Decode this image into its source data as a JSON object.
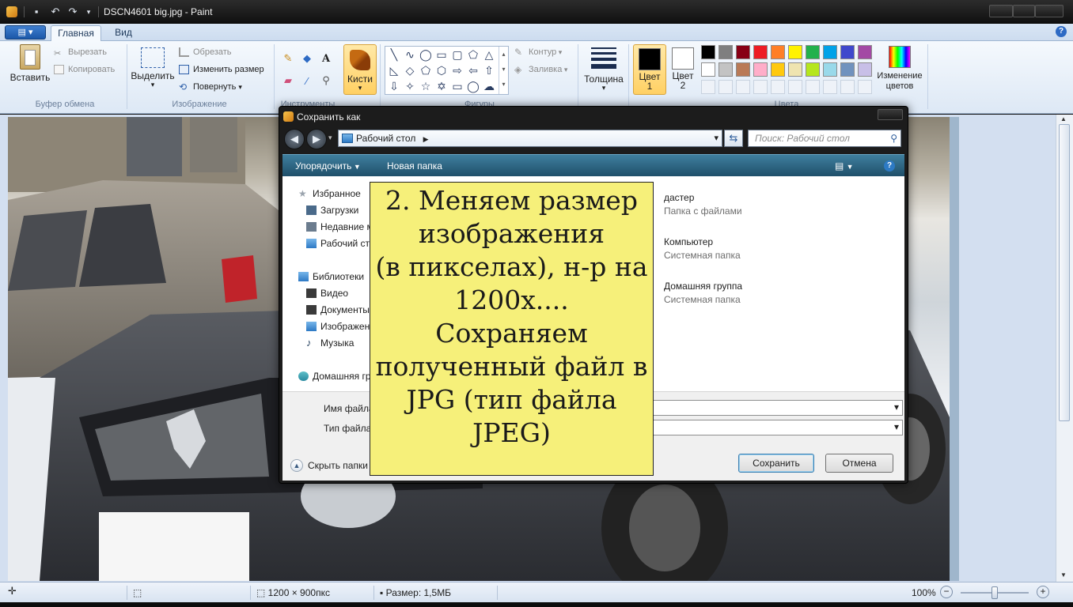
{
  "window": {
    "title": "DSCN4601 big.jpg - Paint"
  },
  "ribbon": {
    "tabs": [
      "Главная",
      "Вид"
    ],
    "clipboard": {
      "paste": "Вставить",
      "cut": "Вырезать",
      "copy": "Копировать",
      "label": "Буфер обмена"
    },
    "image": {
      "select": "Выделить",
      "crop": "Обрезать",
      "resize": "Изменить размер",
      "rotate": "Повернуть",
      "label": "Изображение"
    },
    "tools": {
      "label": "Инструменты"
    },
    "brushes": {
      "label": "Кисти"
    },
    "shapes": {
      "outline": "Контур",
      "fill": "Заливка",
      "label": "Фигуры"
    },
    "size": {
      "label": "Толщина"
    },
    "colors": {
      "color1": "Цвет",
      "color1_num": "1",
      "color2": "Цвет",
      "color2_num": "2",
      "edit": "Изменение цветов",
      "label": "Цвета",
      "palette_row1": [
        "#000000",
        "#7f7f7f",
        "#880015",
        "#ed1c24",
        "#ff7f27",
        "#fff200",
        "#22b14c",
        "#00a2e8",
        "#3f48cc",
        "#a349a4"
      ],
      "palette_row2": [
        "#ffffff",
        "#c3c3c3",
        "#b97a57",
        "#ffaec9",
        "#ffc90e",
        "#efe4b0",
        "#b5e61d",
        "#99d9ea",
        "#7092be",
        "#c8bfe7"
      ]
    }
  },
  "dialog": {
    "title": "Сохранить как",
    "address": "Рабочий стол",
    "search_placeholder": "Поиск: Рабочий стол",
    "commands": {
      "organize": "Упорядочить",
      "new_folder": "Новая папка"
    },
    "nav": {
      "favorites": "Избранное",
      "downloads": "Загрузки",
      "recent": "Недавние места",
      "desktop": "Рабочий стол",
      "libraries": "Библиотеки",
      "video": "Видео",
      "documents": "Документы",
      "images": "Изображения",
      "music": "Музыка",
      "homegroup": "Домашняя группа"
    },
    "files": [
      {
        "name": "дастер",
        "type": "Папка с файлами"
      },
      {
        "name": "Компьютер",
        "type": "Системная папка"
      },
      {
        "name": "Домашняя группа",
        "type": "Системная папка"
      }
    ],
    "filename_label": "Имя файла:",
    "filetype_label": "Тип файла:",
    "hide_folders": "Скрыть папки",
    "save": "Сохранить",
    "cancel": "Отмена"
  },
  "note": {
    "lines": [
      "2. Меняем размер",
      "изображения",
      "(в пикселах), н-р на",
      "1200х....",
      "Сохраняем",
      "полученный файл в",
      "JPG (тип файла",
      "JPEG)"
    ]
  },
  "status": {
    "dimensions": "1200 × 900пкс",
    "size": "Размер: 1,5МБ",
    "zoom": "100%"
  }
}
